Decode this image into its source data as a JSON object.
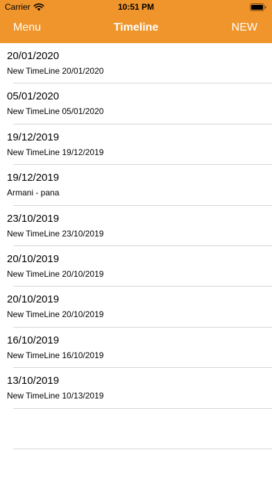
{
  "status_bar": {
    "carrier": "Carrier",
    "time": "10:51 PM",
    "icons": [
      "wifi-icon",
      "battery-icon"
    ]
  },
  "nav": {
    "left_label": "Menu",
    "title": "Timeline",
    "right_label": "NEW",
    "color": "#f0952b"
  },
  "timelines": [
    {
      "title": "20/01/2020",
      "subtitle": "New TimeLine 20/01/2020"
    },
    {
      "title": "05/01/2020",
      "subtitle": "New TimeLine 05/01/2020"
    },
    {
      "title": "19/12/2019",
      "subtitle": "New TimeLine 19/12/2019"
    },
    {
      "title": "19/12/2019",
      "subtitle": "Armani - pana"
    },
    {
      "title": "23/10/2019",
      "subtitle": "New TimeLine 23/10/2019"
    },
    {
      "title": "20/10/2019",
      "subtitle": "New TimeLine 20/10/2019"
    },
    {
      "title": "20/10/2019",
      "subtitle": "New TimeLine 20/10/2019"
    },
    {
      "title": "16/10/2019",
      "subtitle": "New TimeLine 16/10/2019"
    },
    {
      "title": "13/10/2019",
      "subtitle": "New TimeLine 10/13/2019"
    }
  ]
}
